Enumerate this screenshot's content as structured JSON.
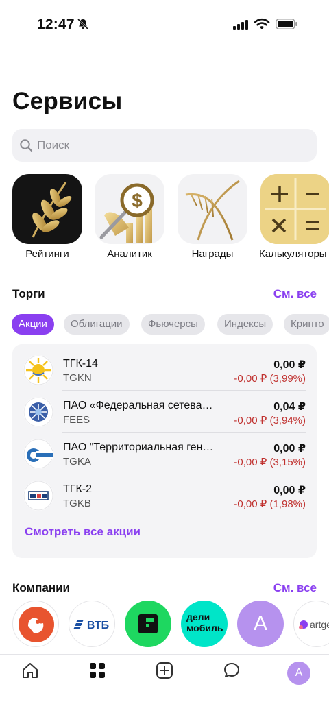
{
  "status_bar": {
    "time": "12:47"
  },
  "page": {
    "title": "Сервисы"
  },
  "search": {
    "placeholder": "Поиск"
  },
  "services": [
    {
      "label": "Рейтинги",
      "icon": "laurel-icon"
    },
    {
      "label": "Аналитик",
      "icon": "analyst-icon"
    },
    {
      "label": "Награды",
      "icon": "awards-icon"
    },
    {
      "label": "Калькуляторы",
      "icon": "calculator-icon"
    }
  ],
  "trading": {
    "title": "Торги",
    "see_all": "См. все",
    "chips": [
      "Акции",
      "Облигации",
      "Фьючерсы",
      "Индексы",
      "Крипто"
    ],
    "active_chip": "Акции",
    "stocks": [
      {
        "name": "ТГК-14",
        "ticker": "TGKN",
        "price": "0,00 ₽",
        "change": "-0,00 ₽ (3,99%)"
      },
      {
        "name": "ПАО «Федеральная сетева…",
        "ticker": "FEES",
        "price": "0,04 ₽",
        "change": "-0,00 ₽ (3,94%)"
      },
      {
        "name": "ПАО \"Территориальная ген…",
        "ticker": "TGKA",
        "price": "0,00 ₽",
        "change": "-0,00 ₽ (3,15%)"
      },
      {
        "name": "ТГК-2",
        "ticker": "TGKB",
        "price": "0,00 ₽",
        "change": "-0,00 ₽ (1,98%)"
      }
    ],
    "view_all_label": "Смотреть все акции"
  },
  "companies": {
    "title": "Компании",
    "see_all": "См. все",
    "items": [
      {
        "logo_text": "",
        "color": "#e8542f"
      },
      {
        "logo_text": "ВТБ",
        "color": "#1a4fa3"
      },
      {
        "logo_text": "",
        "color": "#1ed760"
      },
      {
        "logo_text": "дели мобиль",
        "color": "#00e5c8"
      },
      {
        "logo_text": "A",
        "color": "#b692ee"
      },
      {
        "logo_text": "artge",
        "color": "#8a3ff0"
      }
    ]
  },
  "tab_bar": {
    "avatar_letter": "A"
  },
  "colors": {
    "accent": "#8a3ff0",
    "negative": "#c0312f"
  }
}
